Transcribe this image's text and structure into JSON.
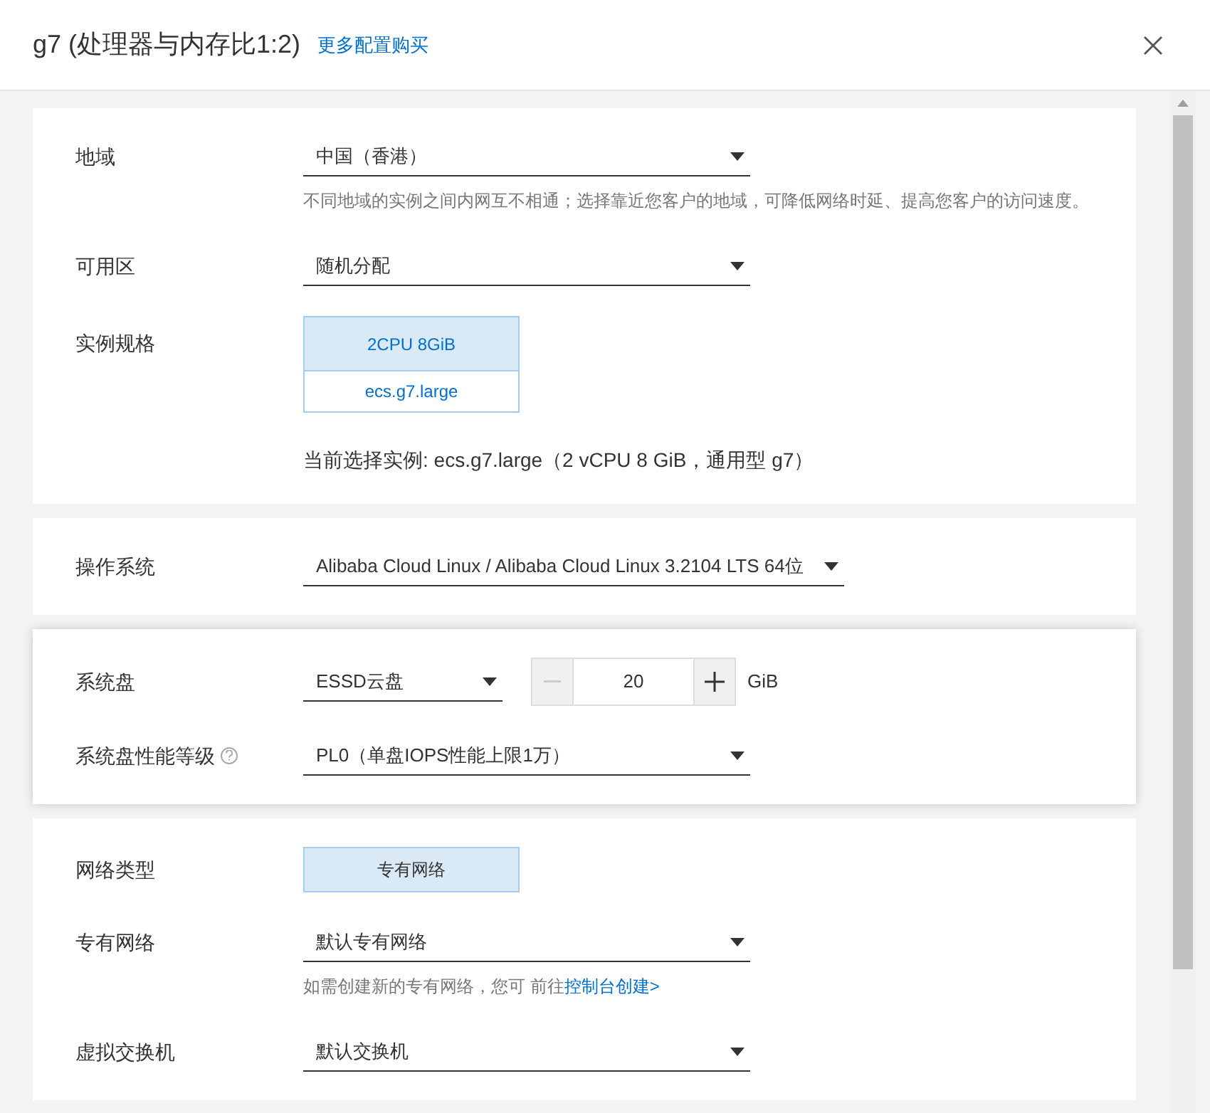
{
  "header": {
    "title": "g7 (处理器与内存比1:2)",
    "link": "更多配置购买"
  },
  "sections": [
    {
      "highlighted": false,
      "rows": [
        {
          "kind": "select",
          "label": "地域",
          "value": "中国（香港）",
          "hint": "不同地域的实例之间内网互不相通；选择靠近您客户的地域，可降低网络时延、提高您客户的访问速度。"
        },
        {
          "kind": "select",
          "label": "可用区",
          "value": "随机分配"
        },
        {
          "kind": "spec",
          "label": "实例规格",
          "spec": "2CPU 8GiB",
          "type": "ecs.g7.large",
          "note": "当前选择实例: ecs.g7.large（2 vCPU 8 GiB，通用型 g7）"
        }
      ]
    },
    {
      "highlighted": false,
      "rows": [
        {
          "kind": "select-wide",
          "label": "操作系统",
          "value": "Alibaba Cloud Linux / Alibaba Cloud Linux 3.2104 LTS 64位"
        }
      ]
    },
    {
      "highlighted": true,
      "rows": [
        {
          "kind": "disk",
          "label": "系统盘",
          "value": "ESSD云盘",
          "amount": "20",
          "unit": "GiB",
          "minus_disabled": true
        },
        {
          "kind": "select",
          "label": "系统盘性能等级",
          "help": true,
          "value": "PL0（单盘IOPS性能上限1万）"
        }
      ]
    },
    {
      "highlighted": false,
      "rows": [
        {
          "kind": "choice",
          "label": "网络类型",
          "value": "专有网络"
        },
        {
          "kind": "select",
          "label": "专有网络",
          "value": "默认专有网络",
          "hint": "如需创建新的专有网络，您可 前往",
          "hint_link": "控制台创建>"
        },
        {
          "kind": "select",
          "label": "虚拟交换机",
          "value": "默认交换机"
        }
      ]
    }
  ]
}
